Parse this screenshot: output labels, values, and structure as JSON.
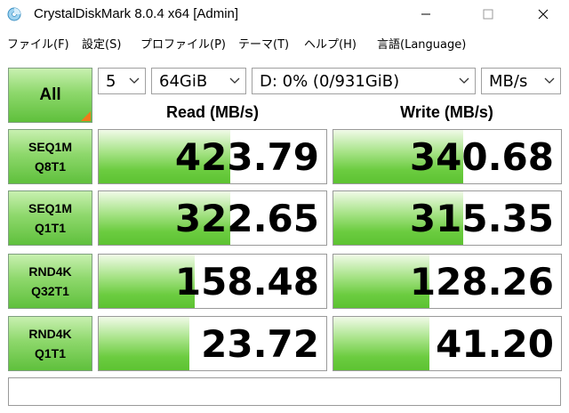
{
  "window": {
    "title": "CrystalDiskMark 8.0.4 x64 [Admin]",
    "icons": [
      "app-icon",
      "minimize-icon",
      "maximize-icon",
      "close-icon"
    ]
  },
  "menu": [
    {
      "label": "ファイル(F)"
    },
    {
      "label": "設定(S)"
    },
    {
      "label": "プロファイル(P)"
    },
    {
      "label": "テーマ(T)"
    },
    {
      "label": "ヘルプ(H)"
    },
    {
      "label": "言語(Language)"
    }
  ],
  "controls": {
    "all_label": "All",
    "count": "5",
    "size": "64GiB",
    "drive": "D: 0% (0/931GiB)",
    "unit": "MB/s"
  },
  "headers": {
    "read": "Read (MB/s)",
    "write": "Write (MB/s)"
  },
  "rows": [
    {
      "line1": "SEQ1M",
      "line2": "Q8T1",
      "read": "423.79",
      "write": "340.68",
      "read_fill": 0.58,
      "write_fill": 0.57
    },
    {
      "line1": "SEQ1M",
      "line2": "Q1T1",
      "read": "322.65",
      "write": "315.35",
      "read_fill": 0.58,
      "write_fill": 0.57
    },
    {
      "line1": "RND4K",
      "line2": "Q32T1",
      "read": "158.48",
      "write": "128.26",
      "read_fill": 0.42,
      "write_fill": 0.42
    },
    {
      "line1": "RND4K",
      "line2": "Q1T1",
      "read": "23.72",
      "write": "41.20",
      "read_fill": 0.4,
      "write_fill": 0.42
    }
  ],
  "status": "",
  "colors": {
    "accent_green": "#6ccc40",
    "corner_orange": "#f07a1a"
  }
}
